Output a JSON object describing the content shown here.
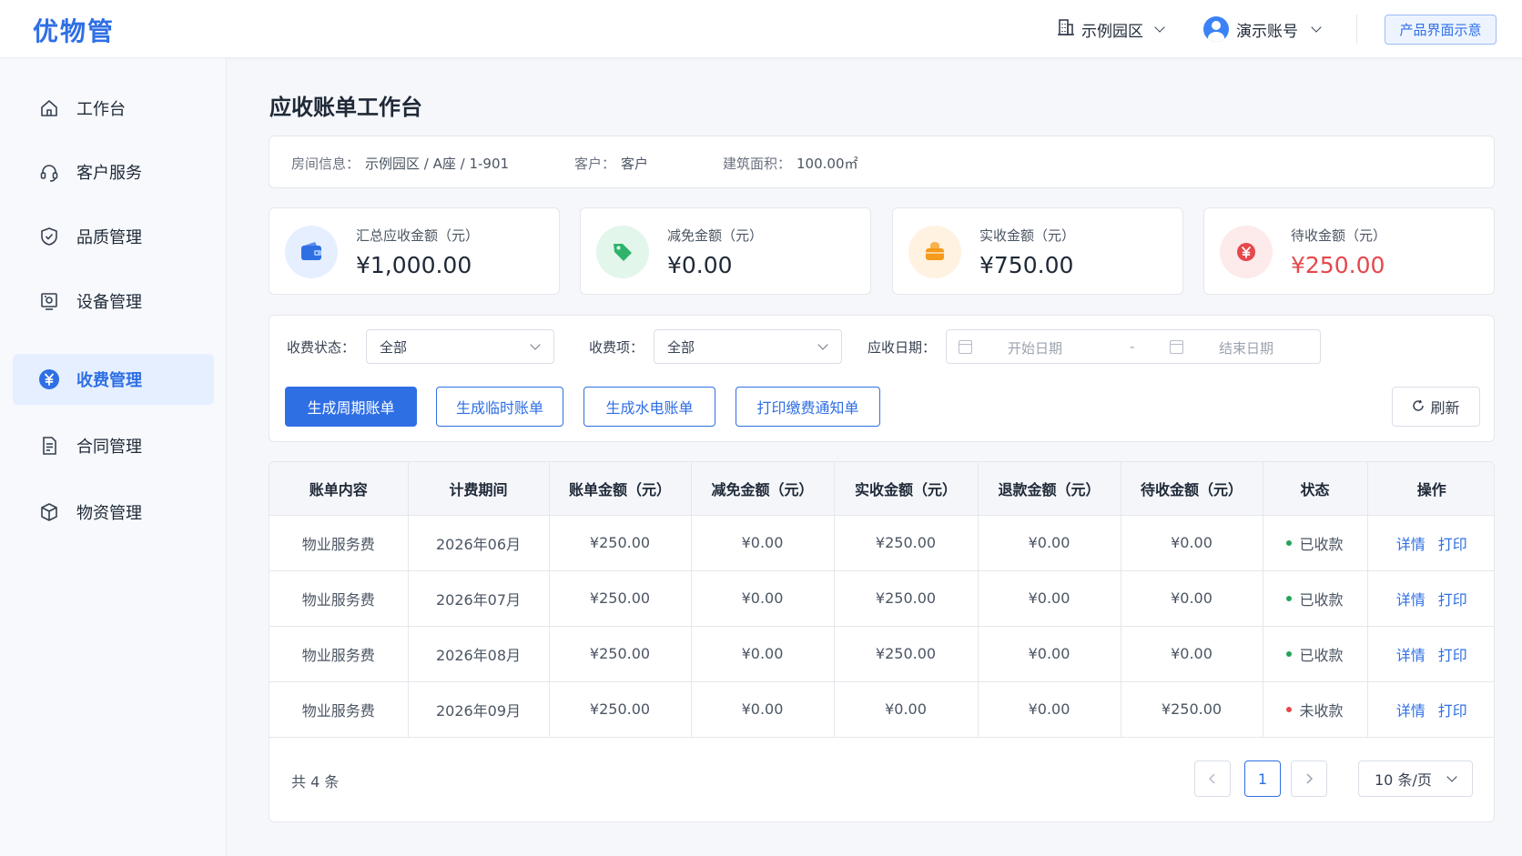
{
  "app": {
    "logo": "优物管",
    "park": "示例园区",
    "account": "演示账号",
    "demo_badge": "产品界面示意"
  },
  "sidebar": {
    "items": [
      {
        "label": "工作台",
        "icon": "home-icon"
      },
      {
        "label": "客户服务",
        "icon": "headset-icon"
      },
      {
        "label": "品质管理",
        "icon": "shield-check-icon"
      },
      {
        "label": "设备管理",
        "icon": "device-icon"
      },
      {
        "label": "收费管理",
        "icon": "yen-circle-icon",
        "active": true
      },
      {
        "label": "合同管理",
        "icon": "document-icon"
      },
      {
        "label": "物资管理",
        "icon": "box-icon"
      }
    ]
  },
  "page": {
    "title": "应收账单工作台"
  },
  "info": {
    "room_label": "房间信息：",
    "room_value": "示例园区 / A座 / 1-901",
    "customer_label": "客户：",
    "customer_value": "客户",
    "area_label": "建筑面积：",
    "area_value": "100.00㎡"
  },
  "stats": [
    {
      "label": "汇总应收金额（元）",
      "value": "¥1,000.00",
      "icon": "wallet-icon"
    },
    {
      "label": "减免金额（元）",
      "value": "¥0.00",
      "icon": "tag-icon"
    },
    {
      "label": "实收金额（元）",
      "value": "¥750.00",
      "icon": "coin-purse-icon"
    },
    {
      "label": "待收金额（元）",
      "value": "¥250.00",
      "icon": "pending-yen-icon"
    }
  ],
  "filters": {
    "status_label": "收费状态：",
    "status_value": "全部",
    "item_label": "收费项：",
    "item_value": "全部",
    "date_label": "应收日期：",
    "start_placeholder": "开始日期",
    "separator": "-",
    "end_placeholder": "结束日期"
  },
  "actions": {
    "gen_cycle": "生成周期账单",
    "gen_temp": "生成临时账单",
    "gen_utility": "生成水电账单",
    "print_notice": "打印缴费通知单",
    "refresh": "刷新"
  },
  "table": {
    "columns": [
      "账单内容",
      "计费期间",
      "账单金额（元）",
      "减免金额（元）",
      "实收金额（元）",
      "退款金额（元）",
      "待收金额（元）",
      "状态",
      "操作"
    ],
    "rows": [
      {
        "content": "物业服务费",
        "period": "2026年06月",
        "amount": "¥250.00",
        "discount": "¥0.00",
        "received": "¥250.00",
        "refund": "¥0.00",
        "pending": "¥0.00",
        "status": "已收款",
        "status_color": "#22a55a",
        "detail": "详情",
        "print": "打印"
      },
      {
        "content": "物业服务费",
        "period": "2026年07月",
        "amount": "¥250.00",
        "discount": "¥0.00",
        "received": "¥250.00",
        "refund": "¥0.00",
        "pending": "¥0.00",
        "status": "已收款",
        "status_color": "#22a55a",
        "detail": "详情",
        "print": "打印"
      },
      {
        "content": "物业服务费",
        "period": "2026年08月",
        "amount": "¥250.00",
        "discount": "¥0.00",
        "received": "¥250.00",
        "refund": "¥0.00",
        "pending": "¥0.00",
        "status": "已收款",
        "status_color": "#22a55a",
        "detail": "详情",
        "print": "打印"
      },
      {
        "content": "物业服务费",
        "period": "2026年09月",
        "amount": "¥250.00",
        "discount": "¥0.00",
        "received": "¥0.00",
        "refund": "¥0.00",
        "pending": "¥250.00",
        "status": "未收款",
        "status_color": "#e5484d",
        "detail": "详情",
        "print": "打印"
      }
    ]
  },
  "pagination": {
    "total": "共 4 条",
    "current_page": "1",
    "page_size": "10 条/页"
  },
  "colors": {
    "accent": "#2f6fe4",
    "paid": "#22a55a",
    "unpaid": "#e5484d"
  }
}
